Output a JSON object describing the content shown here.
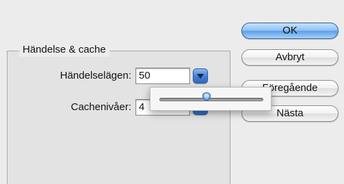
{
  "group": {
    "title": "Händelse & cache"
  },
  "fields": {
    "history_label": "Händelselägen:",
    "history_value": "50",
    "cache_label": "Cachenivåer:",
    "cache_value": "4"
  },
  "buttons": {
    "ok": "OK",
    "cancel": "Avbryt",
    "previous": "Föregående",
    "next": "Nästa"
  },
  "slider": {
    "level": 0.45
  },
  "colors": {
    "accent": "#5d9ee9",
    "background": "#ececec"
  },
  "icons": {
    "stepper": "chevron-down-icon"
  }
}
